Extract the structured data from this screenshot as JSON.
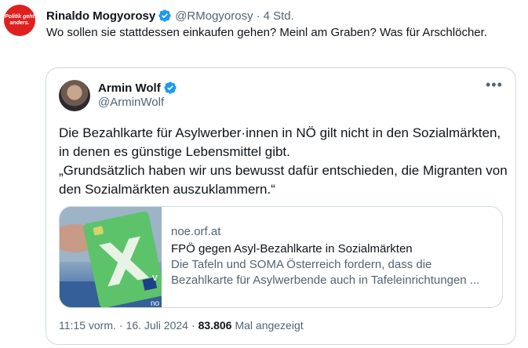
{
  "outer_tweet": {
    "avatar_text": "Politik geht anders.",
    "name": "Rinaldo Mogyorosy",
    "handle": "@RMogyorosy",
    "separator": "·",
    "time": "4 Std.",
    "text": "Wo sollen sie stattdessen einkaufen gehen? Meinl am Graben? Was für Arschlöcher."
  },
  "quoted_tweet": {
    "name": "Armin Wolf",
    "handle": "@ArminWolf",
    "more_icon": "•••",
    "text_line1": "Die Bezahlkarte für Asylwerber·innen in NÖ gilt nicht in den Sozialmärkten, in denen es günstige Lebensmittel gibt.",
    "text_line2": "„Grundsätzlich haben wir uns bewusst dafür entschieden, die Migranten von den Sozialmärkten auszuklammern.“",
    "link_card": {
      "domain": "noe.orf.at",
      "title": "FPÖ gegen Asyl-Bezahlkarte in Sozialmärkten",
      "description_line1": "Die Tafeln und SOMA Österreich fordern, dass die",
      "description_line2": "Bezahlkarte für Asylwerbende auch in Tafeleinrichtungen ...",
      "thumb_card_letter": "V",
      "thumb_corner_text": "no"
    },
    "time": "11:15 vorm.",
    "date": "16. Juli 2024",
    "separator": "·",
    "views": "83.806",
    "views_label": "Mal angezeigt"
  },
  "colors": {
    "verified": "#1d9bf0",
    "secondary_text": "#536471",
    "border": "#cfd9de",
    "brand_red": "#e0201e"
  }
}
